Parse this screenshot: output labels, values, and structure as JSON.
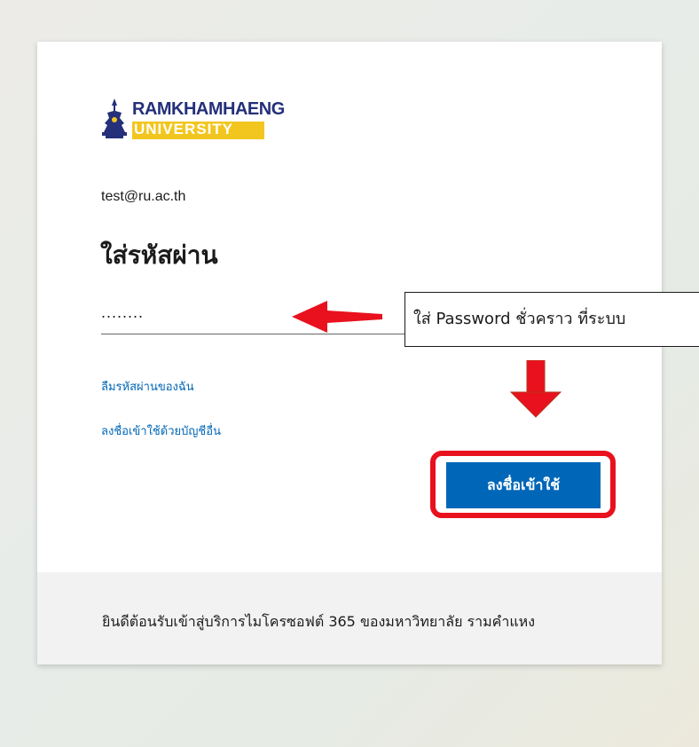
{
  "logo": {
    "name": "RAMKHAMHAENG",
    "sub": "UNIVERSITY"
  },
  "signin": {
    "account": "test@ru.ac.th",
    "title": "ใส่รหัสผ่าน",
    "password_value": "........",
    "forgot_link": "ลืมรหัสผ่านของฉัน",
    "other_account_link": "ลงชื่อเข้าใช้ด้วยบัญชีอื่น",
    "signin_button": "ลงชื่อเข้าใช้"
  },
  "footer": {
    "welcome_text": "ยินดีต้อนรับเข้าสู่บริการไมโครซอฟต์ 365 ของมหาวิทยาลัย รามคำแหง"
  },
  "annotation": {
    "callout_text": "ใส่ Password ชั่วคราว ที่ระบบ",
    "arrow_color": "#e8111d",
    "highlight_color": "#e8111d"
  },
  "colors": {
    "accent": "#0067b8",
    "logo_blue": "#24307a",
    "logo_gold": "#f2c61f"
  },
  "icons": [
    "university-seal-icon",
    "arrow-left-icon",
    "arrow-down-icon"
  ]
}
